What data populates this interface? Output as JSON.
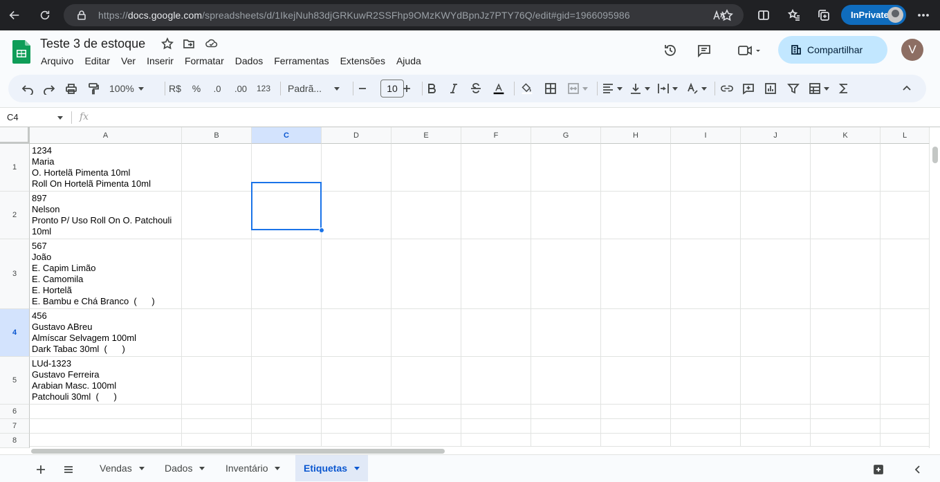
{
  "browser": {
    "url_prefix": "https://",
    "url_host": "docs.google.com",
    "url_path": "/spreadsheets/d/1IkejNuh83djGRKuwR2SSFhp9OMzKWYdBpnJz7PTY76Q/edit#gid=1966095986",
    "inprivate_label": "InPrivate"
  },
  "doc": {
    "title": "Teste 3 de estoque",
    "menu": [
      "Arquivo",
      "Editar",
      "Ver",
      "Inserir",
      "Formatar",
      "Dados",
      "Ferramentas",
      "Extensões",
      "Ajuda"
    ],
    "share_label": "Compartilhar",
    "account_initial": "V"
  },
  "toolbar": {
    "zoom": "100%",
    "currency": "R$",
    "percent": "%",
    "decrease_decimals": ".0",
    "increase_decimals": ".00",
    "number_format": "123",
    "font": "Padrã...",
    "font_size": "10"
  },
  "formula_bar": {
    "name_box": "C4",
    "fx_label": "fx",
    "content": ""
  },
  "sheet": {
    "columns": [
      "A",
      "B",
      "C",
      "D",
      "E",
      "F",
      "G",
      "H",
      "I",
      "J",
      "K",
      "L"
    ],
    "selected_column": "C",
    "selected_row": "4",
    "rows": [
      {
        "num": "1",
        "a": "1234\nMaria\nO. Hortelã Pimenta 10ml\nRoll On Hortelã Pimenta 10ml"
      },
      {
        "num": "2",
        "a": "897\nNelson\nPronto P/ Uso Roll On O. Patchouli\n10ml"
      },
      {
        "num": "3",
        "a": "567\nJoão\nE. Capim Limão\nE. Camomila\nE. Hortelã\nE. Bambu e Chá Branco  (      )"
      },
      {
        "num": "4",
        "a": "456\nGustavo ABreu\nAlmíscar Selvagem 100ml\nDark Tabac 30ml  (      )"
      },
      {
        "num": "5",
        "a": "LUd-1323\nGustavo Ferreira\nArabian Masc. 100ml\nPatchouli 30ml  (      )"
      },
      {
        "num": "6",
        "a": ""
      },
      {
        "num": "7",
        "a": ""
      },
      {
        "num": "8",
        "a": ""
      }
    ]
  },
  "tabs": {
    "items": [
      "Vendas",
      "Dados",
      "Inventário",
      "Etiquetas"
    ],
    "active": "Etiquetas"
  },
  "colors": {
    "accent": "#0b57d0",
    "selection": "#1a73e8",
    "share_bg": "#c2e7ff",
    "sheets_green": "#0f9d58"
  }
}
